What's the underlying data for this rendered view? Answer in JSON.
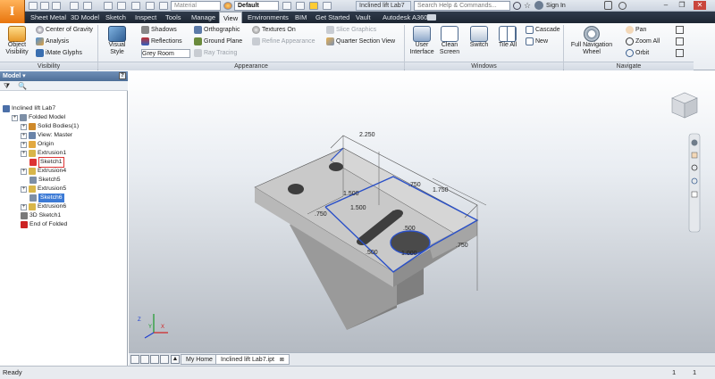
{
  "qat": {
    "material": "Material",
    "appearance": "Default",
    "document_title": "Inclined lift Lab7",
    "help_search_placeholder": "Search Help & Commands...",
    "sign_in": "Sign In"
  },
  "tabs": [
    "Sheet Metal",
    "3D Model",
    "Sketch",
    "Inspect",
    "Tools",
    "Manage",
    "View",
    "Environments",
    "BIM",
    "Get Started",
    "Vault",
    "Autodesk A360"
  ],
  "active_tab": "View",
  "ribbon": {
    "visibility": {
      "label": "Visibility",
      "object_visibility": "Object Visibility",
      "center_of_gravity": "Center of Gravity",
      "analysis": "Analysis",
      "imate_glyphs": "iMate Glyphs"
    },
    "appearance": {
      "label": "Appearance",
      "visual_style": "Visual Style",
      "shadows": "Shadows",
      "reflections": "Reflections",
      "ground_plane": "Ground Plane",
      "ray_tracing": "Ray Tracing",
      "orthographic": "Orthographic",
      "textures_on": "Textures On",
      "refine_appearance": "Refine Appearance",
      "slice_graphics": "Slice Graphics",
      "quarter_section_view": "Quarter Section View",
      "grey_room": "Grey Room"
    },
    "windows": {
      "label": "Windows",
      "user_interface": "User Interface",
      "clean_screen": "Clean Screen",
      "switch": "Switch",
      "tile_all": "Tile All",
      "cascade": "Cascade",
      "new": "New"
    },
    "navigate": {
      "label": "Navigate",
      "full_navigation_wheel": "Full Navigation Wheel",
      "pan": "Pan",
      "zoom_all": "Zoom All",
      "orbit": "Orbit"
    }
  },
  "browser": {
    "title": "Model",
    "help": "?",
    "items": [
      {
        "label": "Inclined lift Lab7",
        "indent": 0
      },
      {
        "label": "Folded Model",
        "indent": 1
      },
      {
        "label": "Solid Bodies(1)",
        "indent": 2
      },
      {
        "label": "View: Master",
        "indent": 2
      },
      {
        "label": "Origin",
        "indent": 2
      },
      {
        "label": "Extrusion1",
        "indent": 2
      },
      {
        "label": "Sketch1",
        "indent": 3
      },
      {
        "label": "Extrusion4",
        "indent": 2
      },
      {
        "label": "Sketch5",
        "indent": 3
      },
      {
        "label": "Extrusion5",
        "indent": 2
      },
      {
        "label": "Sketch6",
        "indent": 3
      },
      {
        "label": "Extrusion6",
        "indent": 2
      },
      {
        "label": "3D Sketch1",
        "indent": 2
      },
      {
        "label": "End of Folded",
        "indent": 2
      }
    ]
  },
  "dimensions": [
    "2.250",
    "1.750",
    ".750",
    "1.500",
    ".750",
    ".500",
    "1.000",
    ".500",
    "1.500",
    ".750"
  ],
  "doc_tabs": {
    "home": "My Home",
    "file": "Inclined lift Lab7.ipt"
  },
  "status": {
    "text": "Ready",
    "count1": "1",
    "count2": "1"
  }
}
